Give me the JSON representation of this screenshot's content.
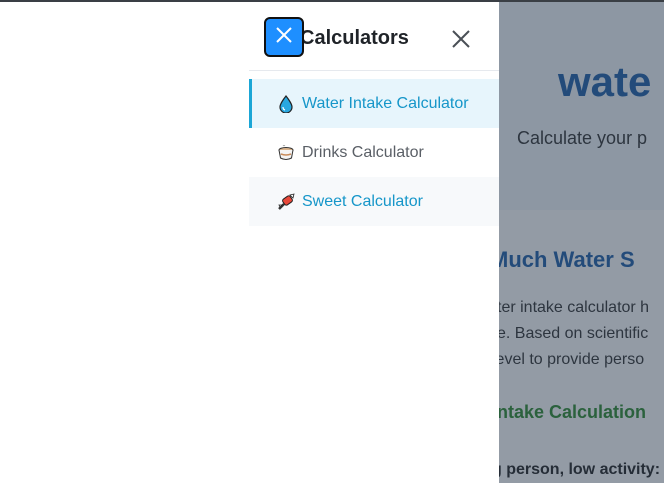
{
  "page": {
    "hero_title": "wate",
    "hero_subtitle": "Calculate your p",
    "section_heading": "Much Water S",
    "para_line1": "ter intake calculator h",
    "para_line2": "e. Based on scientific",
    "para_line3": "level to provide perso",
    "subheading": "Intake Calculation",
    "bold_line": "g person, low activity:"
  },
  "sidebar": {
    "title": "Calculators",
    "items": [
      {
        "label": "Water Intake Calculator",
        "icon": "water-drop-icon",
        "active": true
      },
      {
        "label": "Drinks Calculator",
        "icon": "coffee-cup-icon",
        "active": false
      },
      {
        "label": "Sweet Calculator",
        "icon": "candy-icon",
        "active": false
      }
    ]
  },
  "colors": {
    "accent": "#1696c9",
    "active_bg": "#e7f5fc",
    "toggle_button": "#1e8fff",
    "heading_blue": "#1f5fa8",
    "heading_green": "#2e8b2e"
  }
}
